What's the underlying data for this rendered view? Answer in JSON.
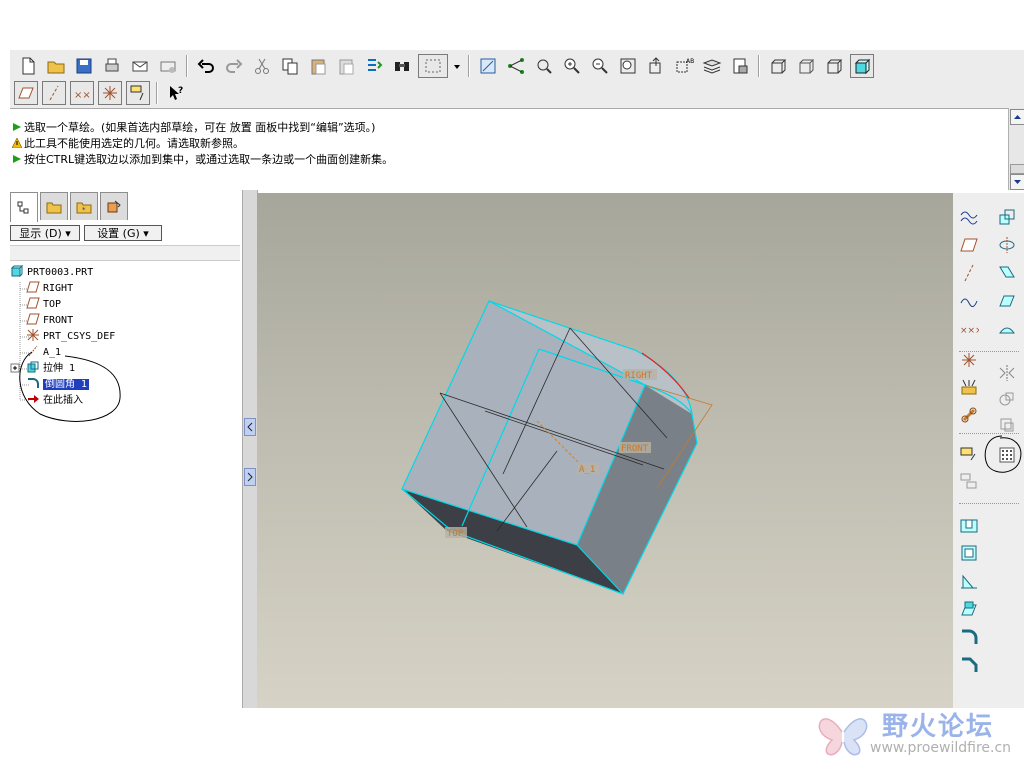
{
  "colors": {
    "accent_cyan": "#00d8e8",
    "tree_red_arrow": "#c00000",
    "label_orange": "#c57a2c",
    "selection_blue": "#1f3fbf"
  },
  "main_toolbar": {
    "row1_icons": [
      "new-file-icon",
      "open-folder-icon",
      "save-icon",
      "print-icon",
      "send-mail-icon",
      "mail-options-icon",
      "undo-icon",
      "redo-icon",
      "cut-icon",
      "copy-icon",
      "paste-icon",
      "paste-special-icon",
      "regenerate-icon",
      "find-icon",
      "select-box-icon",
      "select-dropdown-icon",
      "datum-display-icon",
      "datum-axis-icon",
      "spin-center-icon",
      "zoom-in-icon",
      "zoom-out-icon",
      "refit-icon",
      "reorient-icon",
      "saved-views-icon",
      "layers-icon",
      "view-manager-icon",
      "wireframe-icon",
      "hidden-line-icon",
      "no-hidden-icon",
      "shading-icon"
    ],
    "row2_icons": [
      "plane-display-icon",
      "axis-display-icon",
      "point-display-icon",
      "csys-display-icon",
      "annotation-display-icon",
      "context-help-icon"
    ]
  },
  "messages": [
    {
      "icon": "green-arrow-icon",
      "text": "选取一个草绘。(如果首选内部草绘，可在 放置 面板中找到“编辑”选项。)"
    },
    {
      "icon": "warning-icon",
      "text": "此工具不能使用选定的几何。请选取新参照。"
    },
    {
      "icon": "green-arrow-icon",
      "text": "按住CTRL键选取边以添加到集中，或通过选取一条边或一个曲面创建新集。"
    }
  ],
  "left_panel": {
    "tabs": [
      "model-tree-tab",
      "folder-browser-tab",
      "favorites-tab",
      "connections-tab"
    ],
    "show_menu": "显示 (D) ▾",
    "settings_menu": "设置 (G) ▾",
    "tree": [
      {
        "label": "PRT0003.PRT",
        "icon": "part-icon",
        "indent": 0
      },
      {
        "label": "RIGHT",
        "icon": "datum-plane-icon",
        "indent": 1
      },
      {
        "label": "TOP",
        "icon": "datum-plane-icon",
        "indent": 1
      },
      {
        "label": "FRONT",
        "icon": "datum-plane-icon",
        "indent": 1
      },
      {
        "label": "PRT_CSYS_DEF",
        "icon": "csys-icon",
        "indent": 1
      },
      {
        "label": "A_1",
        "icon": "axis-icon",
        "indent": 1
      },
      {
        "label": "拉伸 1",
        "icon": "extrude-icon",
        "indent": 1
      },
      {
        "label": "倒圆角 1",
        "icon": "round-icon",
        "indent": 1,
        "selected": true
      },
      {
        "label": "在此插入",
        "icon": "insert-here-icon",
        "indent": 1
      }
    ]
  },
  "viewport": {
    "labels": {
      "right": "RIGHT",
      "front": "FRONT",
      "top": "TOP",
      "axis": "A_1"
    }
  },
  "right_toolbar": {
    "icons": [
      "sketched-datum-curve-icon",
      "datum-plane-tool-icon",
      "datum-axis-tool-icon",
      "datum-curve-icon",
      "datum-point-icon",
      "csys-tool-icon",
      "analysis-feature-icon",
      "chain-icon",
      "extrude-tool-icon",
      "revolve-tool-icon",
      "sweep-tool-icon",
      "blend-tool-icon",
      "boundary-blend-icon",
      "mirror-icon",
      "merge-icon",
      "trim-icon",
      "pattern-icon",
      "copy-tool-icon",
      "hole-icon",
      "shell-icon",
      "rib-icon",
      "draft-icon",
      "round-icon",
      "chamfer-icon"
    ]
  },
  "watermark": {
    "title": "野火论坛",
    "url": "www.proewildfire.cn"
  }
}
